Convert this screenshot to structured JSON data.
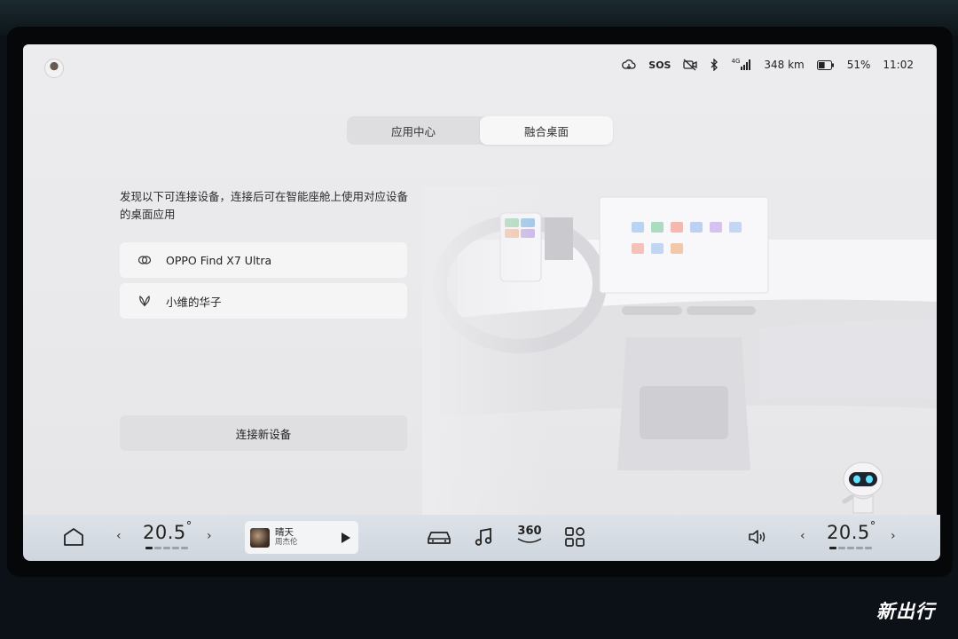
{
  "status_bar": {
    "sos": "SOS",
    "signal_label": "4G",
    "range": "348 km",
    "battery_percent": "51%",
    "time": "11:02",
    "battery_level": 0.51
  },
  "tabs": [
    {
      "label": "应用中心",
      "active": false
    },
    {
      "label": "融合桌面",
      "active": true
    }
  ],
  "description": "发现以下可连接设备，连接后可在智能座舱上使用对应设备的桌面应用",
  "devices": [
    {
      "name": "OPPO Find X7 Ultra",
      "icon": "oppo-logo-icon"
    },
    {
      "name": "小维的华子",
      "icon": "huawei-logo-icon"
    }
  ],
  "connect_button": "连接新设备",
  "dock": {
    "left_temp": "20.5",
    "right_temp": "20.5",
    "degree": "°",
    "music_title": "晴天",
    "music_artist": "周杰伦",
    "temp_360": "360",
    "icons": [
      "home-icon",
      "car-icon",
      "music-note-icon",
      "camera-360-icon",
      "apps-grid-icon",
      "volume-icon"
    ]
  },
  "watermark": "新出行",
  "colors": {
    "screen_bg": "#ececee",
    "dock_bg": "#d4dbe3",
    "active_tab": "#f7f7f8"
  }
}
